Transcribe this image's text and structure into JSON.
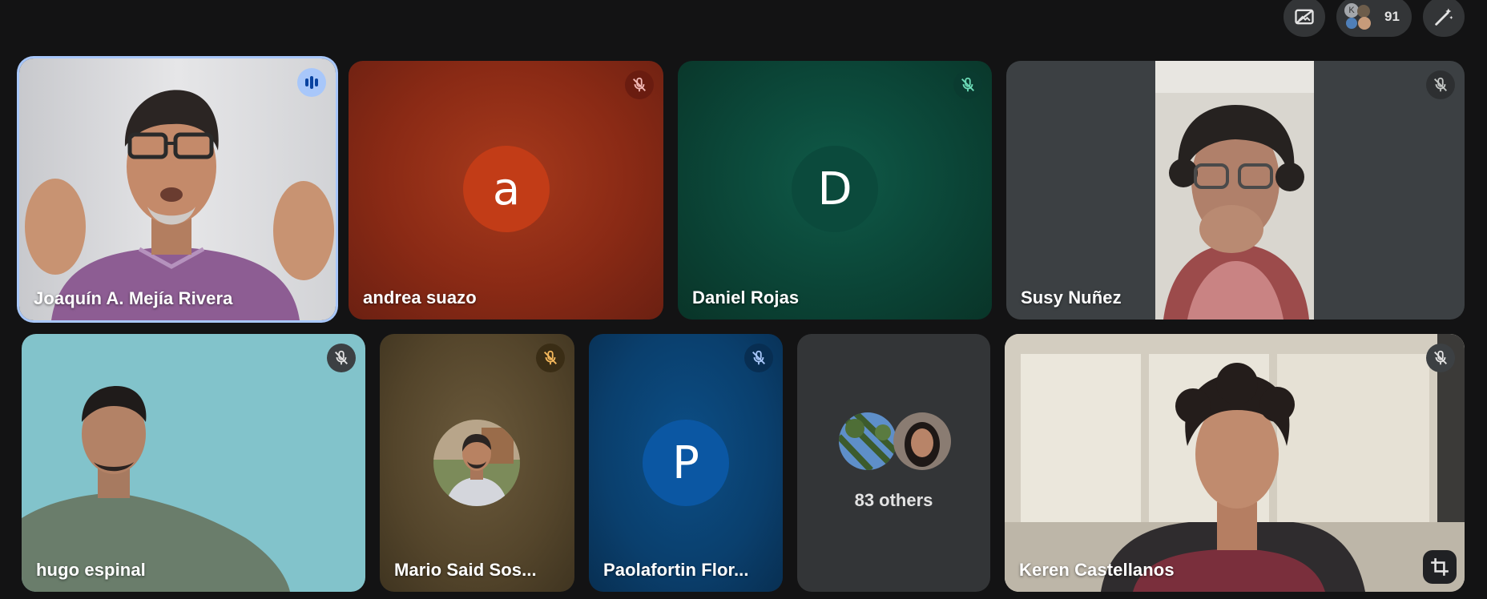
{
  "topbar": {
    "participant_count": "91",
    "participant_initial": "K"
  },
  "participants": [
    {
      "name": "Joaquín A. Mejía Rivera",
      "status": "speaking"
    },
    {
      "name": "andrea suazo",
      "avatar_letter": "a",
      "status": "muted",
      "color": "#b3361a"
    },
    {
      "name": "Daniel Rojas",
      "avatar_letter": "D",
      "status": "muted",
      "color": "#0b4a3c"
    },
    {
      "name": "Susy Nuñez",
      "status": "muted"
    },
    {
      "name": "hugo espinal",
      "status": "muted"
    },
    {
      "name": "Mario Said Sos...",
      "status": "muted"
    },
    {
      "name": "Paolafortin Flor...",
      "avatar_letter": "P",
      "status": "muted",
      "color": "#0b57a3"
    },
    {
      "name": "Keren Castellanos",
      "status": "muted"
    }
  ],
  "others": {
    "label": "83 others"
  },
  "icons": {
    "mic_off": "mic-off-icon",
    "speaking": "audio-bars-icon",
    "no_video_effects": "hide-self-icon",
    "edit_magic": "magic-pen-icon",
    "crop": "crop-icon"
  }
}
